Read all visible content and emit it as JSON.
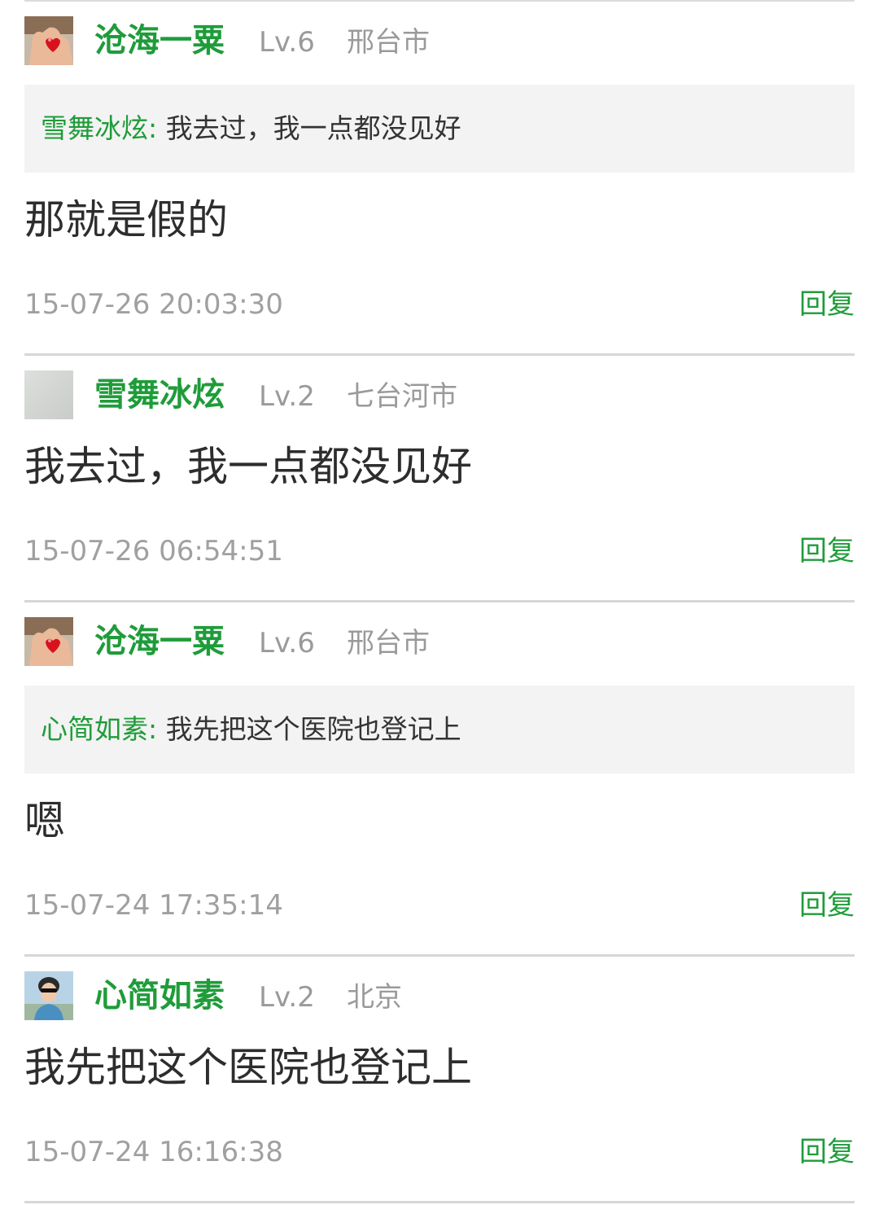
{
  "comments": [
    {
      "username": "沧海一粟",
      "level": "Lv.6",
      "location": "邢台市",
      "avatar": "hand-holding-heart-avatar",
      "quote": {
        "author": "雪舞冰炫:",
        "text": "我去过，我一点都没见好"
      },
      "text": "那就是假的",
      "time": "15-07-26 20:03:30",
      "reply_label": "回复"
    },
    {
      "username": "雪舞冰炫",
      "level": "Lv.2",
      "location": "七台河市",
      "avatar": "grey-blank-avatar",
      "text": "我去过，我一点都没见好",
      "time": "15-07-26 06:54:51",
      "reply_label": "回复"
    },
    {
      "username": "沧海一粟",
      "level": "Lv.6",
      "location": "邢台市",
      "avatar": "hand-holding-heart-avatar",
      "quote": {
        "author": "心简如素:",
        "text": "我先把这个医院也登记上"
      },
      "text": "嗯",
      "time": "15-07-24 17:35:14",
      "reply_label": "回复"
    },
    {
      "username": "心简如素",
      "level": "Lv.2",
      "location": "北京",
      "avatar": "person-sunglasses-avatar",
      "text": "我先把这个医院也登记上",
      "time": "15-07-24 16:16:38",
      "reply_label": "回复"
    }
  ],
  "colors": {
    "accent_green": "#1f9c3a",
    "meta_grey": "#9a9a9a",
    "quote_bg": "#f3f3f3",
    "divider": "#d7d7d7"
  }
}
